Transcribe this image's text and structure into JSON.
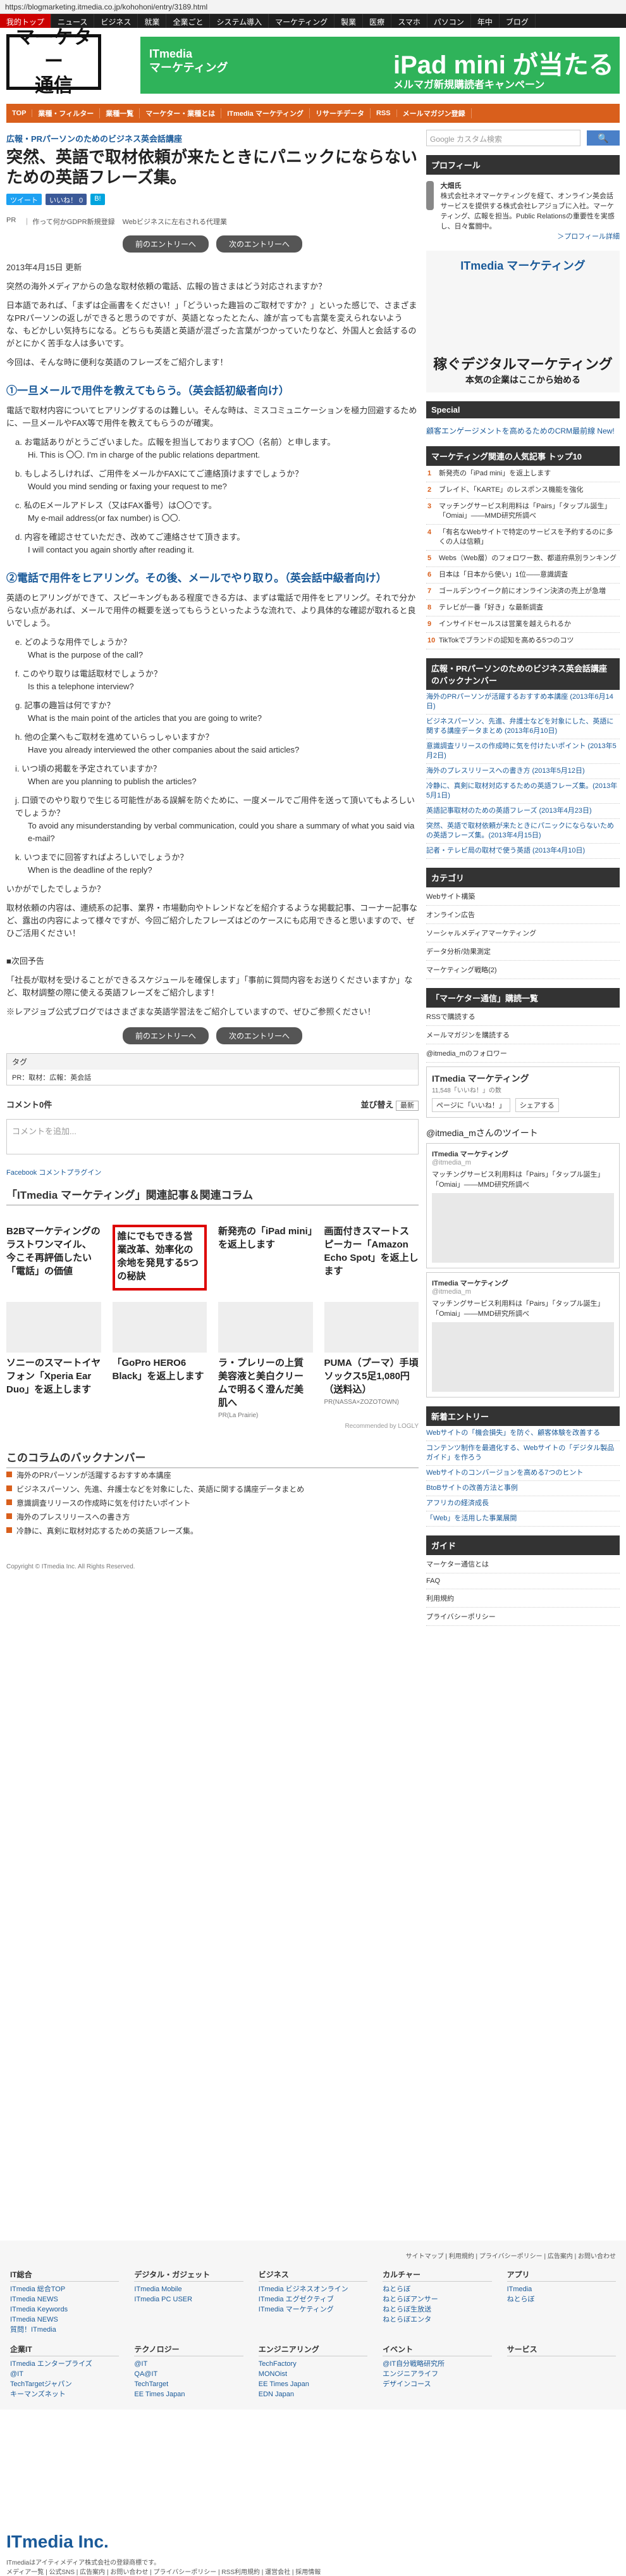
{
  "browser": {
    "url": "https://blogmarketing.itmedia.co.jp/kohohoni/entry/3189.html"
  },
  "globalnav": [
    "我的トップ",
    "ニュース",
    "ビジネス",
    "就業",
    "全業ごと",
    "システム導入",
    "マーケティング",
    "製業",
    "医療",
    "スマホ",
    "パソコン",
    "年中",
    "ブログ"
  ],
  "header": {
    "logo": "マーケター\n通信",
    "banner": {
      "line1": "ITmedia\nマーケティング",
      "main": "iPad mini が当たる",
      "sub": "メルマガ新規購読者キャンペーン"
    }
  },
  "subnav": [
    "TOP",
    "業種・フィルター",
    "業種一覧",
    "マーケター・業種とは",
    "ITmedia マーケティング",
    "リサーチデータ",
    "RSS",
    "メールマガジン登録"
  ],
  "article": {
    "breadcrumb": "広報・PRパーソンのためのビジネス英会話講座",
    "title": "突然、英語で取材依頼が来たときにパニックにならないための英語フレーズ集。",
    "share": [
      "ツイート",
      "いいね！ 0",
      "B!"
    ],
    "pr": [
      "PR",
      "｜ 作って何かGDPR新規登録",
      "Webビジネスに左右される代理業"
    ],
    "pager": [
      "前のエントリーへ",
      "次のエントリーへ"
    ],
    "date": "2013年4月15日 更新",
    "paragraphs": [
      "突然の海外メディアからの急な取材依頼の電話、広報の皆さまはどう対応されますか？",
      "日本語であれば、「まずは企画書をください！」「どういった趣旨のご取材ですか？」といった感じで、さまざまなPRパーソンの返しができると思うのですが、英語となったとたん、誰が言っても言葉を変えられないような、もどかしい気持ちになる。どちらも英語と英語が混ざった言葉がつかっていたりなど、外国人と会話するのがとにかく苦手な人は多いです。",
      "今回は、そんな時に便利な英語のフレーズをご紹介します！"
    ],
    "sections": [
      {
        "heading": "①一旦メールで用件を教えてもらう。（英会話初級者向け）",
        "intro": "電話で取材内容についてヒアリングするのは難しい。そんな時は、ミスコミュニケーションを極力回避するために、一旦メールやFAX等で用件を教えてもらうのが確実。",
        "items": [
          {
            "jp": "a. お電話ありがとうございました。広報を担当しております〇〇（名前）と申します。",
            "en": "Hi. This is 〇〇. I'm in charge of the public relations department."
          },
          {
            "jp": "b. もしよろしければ、ご用件をメールかFAXにてご連絡頂けますでしょうか？",
            "en": "Would you mind sending or faxing your request to me?"
          },
          {
            "jp": "c. 私のEメールアドレス（又はFAX番号）は〇〇です。",
            "en": "My e-mail address(or fax number) is 〇〇."
          },
          {
            "jp": "d. 内容を確認させていただき、改めてご連絡させて頂きます。",
            "en": "I will contact you again shortly after reading it."
          }
        ]
      },
      {
        "heading": "②電話で用件をヒアリング。その後、メールでやり取り。（英会話中級者向け）",
        "intro": "英語のヒアリングができて、スピーキングもある程度できる方は、まずは電話で用件をヒアリング。それで分からない点があれば、メールで用件の概要を送ってもらうといったような流れで、より具体的な確認が取れると良いでしょう。",
        "items": [
          {
            "jp": "e. どのような用件でしょうか？",
            "en": "What is the purpose of the call?"
          },
          {
            "jp": "f. このやり取りは電話取材でしょうか？",
            "en": "Is this a telephone interview?"
          },
          {
            "jp": "g. 記事の趣旨は何ですか？",
            "en": "What is the main point of the articles that you are going to write?"
          },
          {
            "jp": "h. 他の企業へもご取材を進めていらっしゃいますか？",
            "en": "Have you already interviewed the other companies about the said articles?"
          },
          {
            "jp": "i. いつ頃の掲載を予定されていますか？",
            "en": "When are you planning to publish the articles?"
          },
          {
            "jp": "j. 口頭でのやり取りで生じる可能性がある誤解を防ぐために、一度メールでご用件を送って頂いてもよろしいでしょうか？",
            "en": "To avoid any misunderstanding by verbal communication, could you share a summary of what you said via e-mail?"
          },
          {
            "jp": "k. いつまでに回答すればよろしいでしょうか？",
            "en": "When is the deadline of the reply?"
          }
        ]
      }
    ],
    "closing": [
      "いかがでしたでしょうか？",
      "取材依頼の内容は、連続系の記事、業界・市場動向やトレンドなどを紹介するような掲載記事、コーナー記事など、露出の内容によって様々ですが、今回ご紹介したフレーズはどのケースにも応用できると思いますので、ぜひご活用ください！"
    ],
    "next_label": "■次回予告",
    "next_text": "「社長が取材を受けることができるスケジュールを確保します」「事前に質問内容をお送りくださいますか」など、取材調整の際に使える英語フレーズをご紹介します！",
    "blog_note": "※レアジョブ公式ブログではさまざまな英語学習法をご紹介していますので、ぜひご参照ください！",
    "tags_label": "タグ",
    "tags": "PR：取材：広報：英会話",
    "comment_count": "コメント0件",
    "sort_label": "並び替え",
    "sort_value": "最新",
    "comment_placeholder": "コメントを追加...",
    "fb_label": "Facebook コメントプラグイン",
    "related_title": "「ITmedia マーケティング」関連記事＆関連コラム",
    "related": [
      {
        "t": "B2Bマーケティングのラストワンマイル、今こそ再評価したい「電話」の価値",
        "c": ""
      },
      {
        "t": "誰にでもできる営業改革、効率化の余地を発見する5つの秘訣",
        "c": ""
      },
      {
        "t": "新発売の「iPad mini」を返上します",
        "c": ""
      },
      {
        "t": "画面付きスマートスピーカー「Amazon Echo Spot」を返上します",
        "c": ""
      },
      {
        "t": "ソニーのスマートイヤフォン「Xperia Ear Duo」を返上します",
        "c": ""
      },
      {
        "t": "「GoPro HERO6 Black」を返上します",
        "c": ""
      },
      {
        "t": "ラ・プレリーの上質美容液と美白クリームで明るく澄んだ美肌へ",
        "c": "PR(La Prairie)"
      },
      {
        "t": "PUMA（プーマ）手頃ソックス5足1,080円（送料込）",
        "c": "PR(NASSA×ZOZOTOWN)"
      }
    ],
    "recommended": "Recommended by LOGLY",
    "backnumber_title": "このコラムのバックナンバー",
    "backnumber": [
      "海外のPRパーソンが活躍するおすすめ本講座",
      "ビジネスパーソン、先進、弁護士などを対象にした、英語に関する講座データまとめ",
      "意識調査リリースの作成時に気を付けたいポイント",
      "海外のプレスリリースへの書き方",
      "冷静に、真剣に取材対応するための英語フレーズ集。"
    ],
    "copyright": "Copyright © ITmedia Inc. All Rights Reserved."
  },
  "sidebar": {
    "search_placeholder": "Google カスタム検索",
    "search_button": "🔍",
    "profile_title": "プロフィール",
    "profile_name": "大畑氏",
    "profile_text": "株式会社ネオマーケティングを経て、オンライン英会話サービスを提供する株式会社レアジョブに入社。マーケティング、広報を担当。Public Relationsの重要性を実感し、日々奮闘中。",
    "profile_more": "＞プロフィール詳細",
    "itmedia_ad": {
      "head": "ITmedia マーケティング",
      "big": "稼ぐデジタルマーケティング",
      "small": "本気の企業はここから始める"
    },
    "special_title": "Special",
    "special_text": "顧客エンゲージメントを高めるためのCRM最前線 New!",
    "ranking_title": "マーケティング関連の人気記事 トップ10",
    "ranking": [
      "新発売の「iPad mini」を返上します",
      "ブレイド、「KARTE」のレスポンス機能を強化",
      "マッチングサービス利用料は「Pairs」「タップル誕生」「Omiai」――MMD研究所調べ",
      "「有名なWebサイトで特定のサービスを予約するのに多くの人は信頼」",
      "Webs（Web層）のフォロワー数、都道府県別ランキング",
      "日本は「日本から使い」1位――意識調査",
      "ゴールデンウイーク前にオンライン決済の売上が急増",
      "テレビが一番「好き」な最新調査",
      "インサイドセールスは営業を越えられるか",
      "TikTokでブランドの認知を高める5つのコツ"
    ],
    "pr_column_title": "広報・PRパーソンのためのビジネス英会話講座のバックナンバー",
    "pr_column": [
      "海外のPRパーソンが活躍するおすすめ本講座 (2013年6月14日)",
      "ビジネスパーソン、先進、弁護士などを対象にした、英語に関する講座データまとめ (2013年6月10日)",
      "意識調査リリースの作成時に気を付けたいポイント (2013年5月2日)",
      "海外のプレスリリースへの書き方 (2013年5月12日)",
      "冷静に、真剣に取材対応するための英語フレーズ集。(2013年5月1日)",
      "英語記事取材のための英語フレーズ (2013年4月23日)",
      "突然、英語で取材依頼が来たときにパニックにならないための英語フレーズ集。(2013年4月15日)",
      "記者・テレビ局の取材で使う英語 (2013年4月10日)"
    ],
    "category_title": "カテゴリ",
    "categories": [
      "Webサイト構築",
      "オンライン広告",
      "ソーシャルメディアマーケティング",
      "データ分析/効果測定",
      "マーケティング戦略(2)"
    ],
    "rss_title": "「マーケター通信」購読一覧",
    "rss": [
      "RSSで購読する",
      "メールマガジンを購読する",
      "@itmedia_mのフォロワー"
    ],
    "fb_name": "ITmedia マーケティング",
    "fb_likes": "11,548「いいね！」の数",
    "fb_like_btn": "ページに「いいね！」",
    "fb_share": "シェアする",
    "tweet_title": "@itmedia_mさんのツイート",
    "tweets": [
      {
        "name": "ITmedia マーケティング",
        "id": "@itmedia_m",
        "text": "マッチングサービス利用料は「Pairs」「タップル誕生」「Omiai」――MMD研究所調べ"
      },
      {
        "name": "ITmedia マーケティング",
        "id": "@itmedia_m",
        "text": "マッチングサービス利用料は「Pairs」「タップル誕生」「Omiai」――MMD研究所調べ"
      }
    ],
    "new_title": "新着エントリー",
    "new_items": [
      "Webサイトの「機会損失」を防ぐ、顧客体験を改善する",
      "コンテンツ制作を最適化する、Webサイトの「デジタル製品ガイド」を作ろう",
      "Webサイトのコンバージョンを高める7つのヒント",
      "BtoBサイトの改善方法と事例",
      "アフリカの経済成長",
      "「Web」を活用した事業展開"
    ],
    "guide_title": "ガイド",
    "guide": [
      "マーケター通信とは",
      "FAQ",
      "利用規約",
      "プライバシーポリシー"
    ]
  },
  "footer": {
    "links": "サイトマップ | 利用規約 | プライバシーポリシー | 広告案内 | お問い合わせ",
    "cols": [
      {
        "h": "IT総合",
        "items": [
          "ITmedia 総合TOP",
          "ITmedia NEWS",
          "ITmedia Keywords",
          "ITmedia NEWS",
          "質問！ITmedia"
        ]
      },
      {
        "h": "デジタル・ガジェット",
        "items": [
          "ITmedia Mobile",
          "ITmedia PC USER"
        ]
      },
      {
        "h": "ビジネス",
        "items": [
          "ITmedia ビジネスオンライン",
          "ITmedia エグゼクティブ",
          "ITmedia マーケティング"
        ]
      },
      {
        "h": "カルチャー",
        "items": [
          "ねとらぼ",
          "ねとらぼアンサー",
          "ねとらぼ生放送",
          "ねとらぼエンタ"
        ]
      },
      {
        "h": "アプリ",
        "items": [
          "ITmedia",
          "ねとらぼ"
        ]
      }
    ],
    "cols2": [
      {
        "h": "企業IT",
        "items": [
          "ITmedia エンタープライズ",
          "@IT",
          "TechTargetジャパン",
          "キーマンズネット"
        ]
      },
      {
        "h": "テクノロジー",
        "items": [
          "@IT",
          "QA@IT",
          "TechTarget",
          "EE Times Japan"
        ]
      },
      {
        "h": "エンジニアリング",
        "items": [
          "TechFactory",
          "MONOist",
          "EE Times Japan",
          "EDN Japan"
        ]
      },
      {
        "h": "イベント",
        "items": [
          "@IT自分戦略研究所",
          "エンジニアライフ",
          "デザインコース"
        ]
      },
      {
        "h": "サービス",
        "items": []
      }
    ],
    "itmedia": "ITmedia Inc.",
    "company": "ITmediaはアイティメディア株式会社の登録商標です。",
    "bottom": "メディア一覧 | 公式SNS | 広告案内 | お問い合わせ | プライバシーポリシー | RSS利用規約 | 運営会社 | 採用情報"
  }
}
